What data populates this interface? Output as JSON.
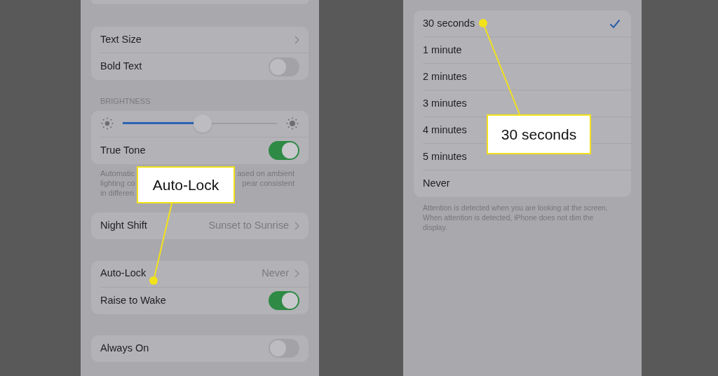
{
  "left_screen": {
    "sections": [
      {
        "rows": [
          {
            "kind": "link",
            "label": "Text Size"
          },
          {
            "kind": "toggle",
            "label": "Bold Text",
            "on": false
          }
        ]
      },
      {
        "header": "BRIGHTNESS",
        "rows": [
          {
            "kind": "slider",
            "level": 0.52
          },
          {
            "kind": "toggle",
            "label": "True Tone",
            "on": true
          }
        ],
        "footnote_lines": [
          [
            "Automatic",
            "ased on ambient"
          ],
          [
            "lighting co",
            "pear consistent"
          ],
          [
            "in differen"
          ]
        ]
      },
      {
        "rows": [
          {
            "kind": "link",
            "label": "Night Shift",
            "value": "Sunset to Sunrise"
          }
        ]
      },
      {
        "rows": [
          {
            "kind": "link",
            "label": "Auto-Lock",
            "value": "Never"
          },
          {
            "kind": "toggle",
            "label": "Raise to Wake",
            "on": true
          }
        ]
      },
      {
        "rows": [
          {
            "kind": "toggle",
            "label": "Always On",
            "on": false
          }
        ]
      }
    ]
  },
  "right_screen": {
    "options": [
      {
        "label": "30 seconds",
        "selected": true
      },
      {
        "label": "1 minute",
        "selected": false
      },
      {
        "label": "2 minutes",
        "selected": false
      },
      {
        "label": "3 minutes",
        "selected": false
      },
      {
        "label": "4 minutes",
        "selected": false
      },
      {
        "label": "5 minutes",
        "selected": false
      },
      {
        "label": "Never",
        "selected": false
      }
    ],
    "footnote": "Attention is detected when you are looking at the screen. When attention is detected, iPhone does not dim the display."
  },
  "callouts": [
    {
      "text": "Auto-Lock"
    },
    {
      "text": "30 seconds"
    }
  ]
}
